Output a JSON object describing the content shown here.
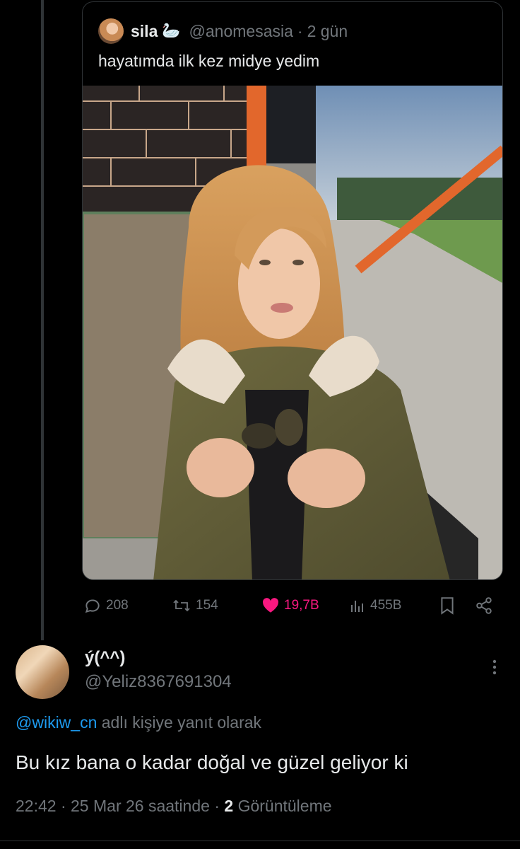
{
  "quoted_tweet": {
    "display_name": "sila",
    "name_emoji": "🦢",
    "handle": "@anomesasia",
    "separator": "·",
    "time_ago": "2 gün",
    "text": "hayatımda ilk kez midye yedim",
    "photo_description": "photo"
  },
  "actions": {
    "replies": "208",
    "retweets": "154",
    "likes": "19,7B",
    "views": "455B"
  },
  "reply": {
    "display_name": "ý(^^)",
    "handle": "@Yeliz8367691304",
    "replying_to_handle": "@wikiw_cn",
    "replying_to_suffix": "adlı kişiye yanıt olarak",
    "text": "Bu kız bana o kadar doğal ve güzel geliyor ki",
    "time": "22:42",
    "date": "25 Mar 26 saatinde",
    "dot": "·",
    "view_count": "2",
    "view_label": "Görüntüleme"
  },
  "colors": {
    "background": "#000000",
    "text_primary": "#e7e9ea",
    "text_secondary": "#71767b",
    "link": "#1d9bf0",
    "like": "#f91880",
    "border": "#2f3336"
  },
  "icons": [
    "reply-icon",
    "retweet-icon",
    "heart-icon",
    "views-icon",
    "bookmark-icon",
    "share-icon",
    "more-icon"
  ]
}
